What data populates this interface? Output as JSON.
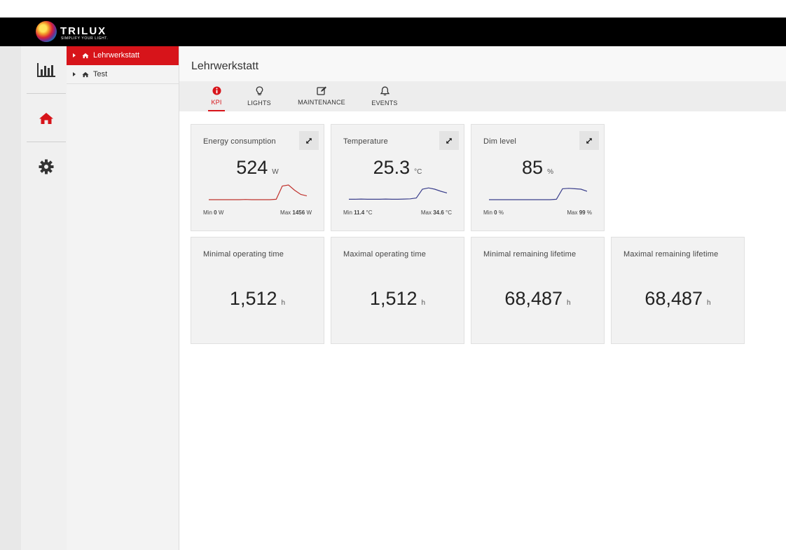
{
  "brand": {
    "name": "TRILUX",
    "tagline": "SIMPLIFY YOUR LIGHT."
  },
  "colors": {
    "accent": "#d7141a",
    "energy_line": "#c0322d",
    "temp_line": "#3b3f8c",
    "dim_line": "#3b3f8c"
  },
  "nav": [
    {
      "icon": "bar-chart-icon"
    },
    {
      "icon": "home-icon",
      "active": true
    },
    {
      "icon": "gear-icon"
    }
  ],
  "tree": {
    "items": [
      {
        "label": "Lehrwerkstatt",
        "icon": "home-icon",
        "active": true
      },
      {
        "label": "Test",
        "icon": "home-icon",
        "active": false
      }
    ]
  },
  "page": {
    "title": "Lehrwerkstatt"
  },
  "tabs": [
    {
      "label": "KPI",
      "icon": "info-icon",
      "active": true
    },
    {
      "label": "LIGHTS",
      "icon": "lightbulb-icon",
      "active": false
    },
    {
      "label": "MAINTENANCE",
      "icon": "edit-icon",
      "active": false
    },
    {
      "label": "EVENTS",
      "icon": "bell-icon",
      "active": false
    }
  ],
  "kpis": {
    "energy": {
      "title": "Energy consumption",
      "value": "524",
      "unit": "W",
      "min_label": "Min",
      "min": "0",
      "min_unit": "W",
      "max_label": "Max",
      "max": "1456",
      "max_unit": "W",
      "trend": [
        0.1,
        0.1,
        0.1,
        0.1,
        0.1,
        0.1,
        0.11,
        0.1,
        0.1,
        0.1,
        0.1,
        0.12,
        0.75,
        0.8,
        0.55,
        0.35,
        0.28
      ]
    },
    "temperature": {
      "title": "Temperature",
      "value": "25.3",
      "unit": "°C",
      "min_label": "Min",
      "min": "11.4",
      "min_unit": "°C",
      "max_label": "Max",
      "max": "34.6",
      "max_unit": "°C",
      "trend": [
        0.12,
        0.12,
        0.13,
        0.12,
        0.12,
        0.12,
        0.13,
        0.12,
        0.12,
        0.13,
        0.14,
        0.18,
        0.6,
        0.66,
        0.6,
        0.5,
        0.42
      ]
    },
    "dim": {
      "title": "Dim level",
      "value": "85",
      "unit": "%",
      "min_label": "Min",
      "min": "0",
      "min_unit": "%",
      "max_label": "Max",
      "max": "99",
      "max_unit": "%",
      "trend": [
        0.1,
        0.1,
        0.1,
        0.1,
        0.1,
        0.1,
        0.1,
        0.1,
        0.1,
        0.1,
        0.1,
        0.12,
        0.62,
        0.64,
        0.62,
        0.6,
        0.5
      ]
    },
    "min_operating": {
      "title": "Minimal operating time",
      "value": "1,512",
      "unit": "h"
    },
    "max_operating": {
      "title": "Maximal operating time",
      "value": "1,512",
      "unit": "h"
    },
    "min_lifetime": {
      "title": "Minimal remaining lifetime",
      "value": "68,487",
      "unit": "h"
    },
    "max_lifetime": {
      "title": "Maximal remaining lifetime",
      "value": "68,487",
      "unit": "h"
    }
  }
}
